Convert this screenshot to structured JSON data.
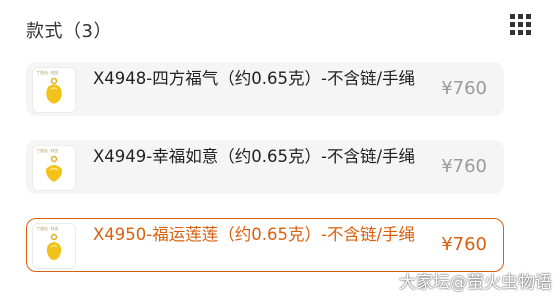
{
  "header": {
    "title": "款式（3）",
    "grid_icon": "grid-dots-icon"
  },
  "items": [
    {
      "name": "X4948-四方福气（约0.65克）-不含链/手绳",
      "price": "¥760",
      "selected": false,
      "thumb_brand": "丁香仙 ·纯金·"
    },
    {
      "name": "X4949-幸福如意（约0.65克）-不含链/手绳",
      "price": "¥760",
      "selected": false,
      "thumb_brand": "丁香仙 ·纯金·"
    },
    {
      "name": "X4950-福运莲莲（约0.65克）-不含链/手绳",
      "price": "¥760",
      "selected": true,
      "thumb_brand": "丁香仙 ·纯金·"
    }
  ],
  "watermark": "大家坛@萤火虫物语",
  "colors": {
    "accent": "#d9600f",
    "gold": "#f2c21b"
  }
}
